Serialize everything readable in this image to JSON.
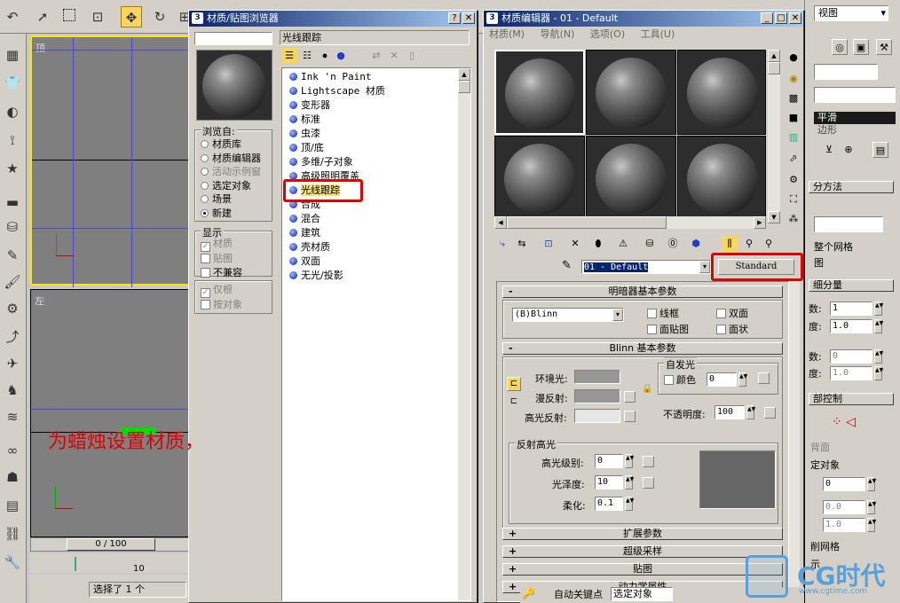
{
  "browser": {
    "title": "材质/贴图浏览器",
    "search_value": "",
    "current_map": "光线跟踪",
    "browse_from": {
      "label": "浏览自:",
      "options": [
        {
          "label": "材质库",
          "selected": false,
          "enabled": true
        },
        {
          "label": "材质编辑器",
          "selected": false,
          "enabled": true
        },
        {
          "label": "活动示例窗",
          "selected": false,
          "enabled": false
        },
        {
          "label": "选定对象",
          "selected": false,
          "enabled": true
        },
        {
          "label": "场景",
          "selected": false,
          "enabled": true
        },
        {
          "label": "新建",
          "selected": true,
          "enabled": true
        }
      ]
    },
    "show": {
      "label": "显示",
      "options": [
        {
          "label": "材质",
          "checked": true,
          "enabled": false
        },
        {
          "label": "贴图",
          "checked": false,
          "enabled": false
        },
        {
          "label": "不兼容",
          "checked": false,
          "enabled": true
        }
      ]
    },
    "filter": {
      "options": [
        {
          "label": "仅根",
          "checked": true,
          "enabled": false
        },
        {
          "label": "按对象",
          "checked": false,
          "enabled": false
        }
      ]
    },
    "materials": [
      "Ink 'n Paint",
      "Lightscape 材质",
      "变形器",
      "标准",
      "虫漆",
      "顶/底",
      "多维/子对象",
      "高级照明覆盖",
      "光线跟踪",
      "合成",
      "混合",
      "建筑",
      "壳材质",
      "双面",
      "无光/投影"
    ]
  },
  "editor": {
    "title": "材质编辑器 - 01 - Default",
    "menu": [
      "材质(M)",
      "导航(N)",
      "选项(O)",
      "工具(U)"
    ],
    "material_name": "01 - Default",
    "material_type": "Standard",
    "shader_rollout": {
      "title": "明暗器基本参数",
      "shader": "(B)Blinn",
      "checks": [
        "线框",
        "双面",
        "面贴图",
        "面状"
      ]
    },
    "blinn_rollout": {
      "title": "Blinn 基本参数",
      "ambient_label": "环境光:",
      "diffuse_label": "漫反射:",
      "specular_label": "高光反射:",
      "self_illum": {
        "group": "自发光",
        "color_label": "颜色",
        "value": "0"
      },
      "opacity": {
        "label": "不透明度:",
        "value": "100"
      },
      "specular_highlights": {
        "group": "反射高光",
        "level_label": "高光级别:",
        "level": "0",
        "gloss_label": "光泽度:",
        "gloss": "10",
        "soften_label": "柔化:",
        "soften": "0.1"
      }
    },
    "rollouts": [
      "扩展参数",
      "超级采样",
      "贴图",
      "动力学属性"
    ]
  },
  "viewports": {
    "top_label": "顶",
    "left_label": "左",
    "timeline": "0 / 100",
    "tick": "10"
  },
  "status": {
    "selected": "选择了 1 个",
    "autokey": "自动关键点",
    "set_key": "选定对象"
  },
  "right_panel": {
    "view_label": "视图",
    "smooth_label": "平滑",
    "sub_label": "边形",
    "sections": [
      {
        "label": "分方法"
      },
      {
        "label": "整个网格"
      },
      {
        "label": "细分量"
      },
      {
        "label": "部控制"
      }
    ],
    "spinners": [
      {
        "label": "数:",
        "value": "1"
      },
      {
        "label": "度:",
        "value": "1.0"
      },
      {
        "label": "数:",
        "value": "0"
      },
      {
        "label": "度:",
        "value": "1.0"
      },
      {
        "label": "",
        "value": "0"
      },
      {
        "label": "",
        "value": "0.0"
      },
      {
        "label": "",
        "value": "1.0"
      }
    ],
    "misc": [
      "背面",
      "定对象",
      "图",
      "削网格",
      "示"
    ]
  },
  "annotation": {
    "text": "为蜡烛设置材质，"
  },
  "watermark": {
    "logo": "CG时代",
    "url": "www.cgtime.com"
  }
}
